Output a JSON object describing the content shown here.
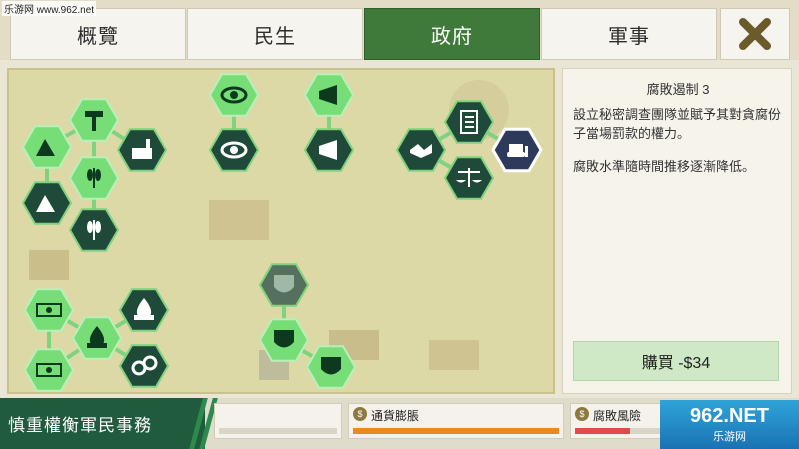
{
  "watermark_top": "乐游网 www.962.net",
  "tabs": [
    {
      "label": "概覽"
    },
    {
      "label": "民生"
    },
    {
      "label": "政府"
    },
    {
      "label": "軍事"
    }
  ],
  "active_tab": "政府",
  "close_icon": "close-x-icon",
  "tree": {
    "nodes": [
      {
        "name": "hammer",
        "icon": "hammer-icon",
        "state": "owned"
      },
      {
        "name": "mining-1",
        "icon": "mountain-icon",
        "state": "owned"
      },
      {
        "name": "factory",
        "icon": "factory-icon",
        "state": "available"
      },
      {
        "name": "agriculture-1",
        "icon": "wheat-icon",
        "state": "owned"
      },
      {
        "name": "mining-2",
        "icon": "mountain-icon",
        "state": "available"
      },
      {
        "name": "agriculture-2",
        "icon": "wheat-icon",
        "state": "available"
      },
      {
        "name": "surveillance",
        "icon": "eye-icon",
        "state": "owned"
      },
      {
        "name": "surveillance-2",
        "icon": "eye-icon",
        "state": "available"
      },
      {
        "name": "propaganda",
        "icon": "megaphone-icon",
        "state": "owned"
      },
      {
        "name": "propaganda-2",
        "icon": "megaphone-icon",
        "state": "available"
      },
      {
        "name": "diplomacy",
        "icon": "handshake-icon",
        "state": "available"
      },
      {
        "name": "checklist",
        "icon": "checklist-icon",
        "state": "available"
      },
      {
        "name": "justice",
        "icon": "scales-icon",
        "state": "available"
      },
      {
        "name": "bulldozer",
        "icon": "bulldozer-icon",
        "state": "selected"
      },
      {
        "name": "defense",
        "icon": "shield-icon",
        "state": "locked"
      },
      {
        "name": "defense-2",
        "icon": "shield-icon",
        "state": "owned"
      },
      {
        "name": "defense-3",
        "icon": "shield-icon",
        "state": "owned"
      },
      {
        "name": "tax-crossed",
        "icon": "money-icon",
        "state": "owned"
      },
      {
        "name": "fire-money",
        "icon": "fire-icon",
        "state": "available"
      },
      {
        "name": "fire-money-2",
        "icon": "fire-icon",
        "state": "owned"
      },
      {
        "name": "money-1",
        "icon": "money-icon",
        "state": "owned"
      },
      {
        "name": "handcuffs",
        "icon": "handcuffs-icon",
        "state": "available"
      }
    ]
  },
  "info": {
    "title": "腐敗遏制 3",
    "description": "設立秘密調查團隊並賦予其對貪腐份子當場罰款的權力。",
    "effect": "腐敗水準隨時間推移逐漸降低。",
    "buy_label": "購買 -$34"
  },
  "bottom": {
    "banner": "慎重權衡軍民事務",
    "meters": [
      {
        "label": "通貨膨脹",
        "icon": "coin-up-icon",
        "fill": 1.0,
        "color": "#e88a1d"
      },
      {
        "label": "腐敗風險",
        "icon": "bribe-icon",
        "fill": 0.65,
        "color": "#e24a4a"
      }
    ],
    "watermark": "962.NET",
    "watermark_sub": "乐游网"
  },
  "colors": {
    "accent": "#3f7a3a",
    "node_owned": "#77dd77",
    "node_available": "#1f4a3a",
    "node_selected": "#2e3a5c",
    "node_locked": "#55705e"
  }
}
